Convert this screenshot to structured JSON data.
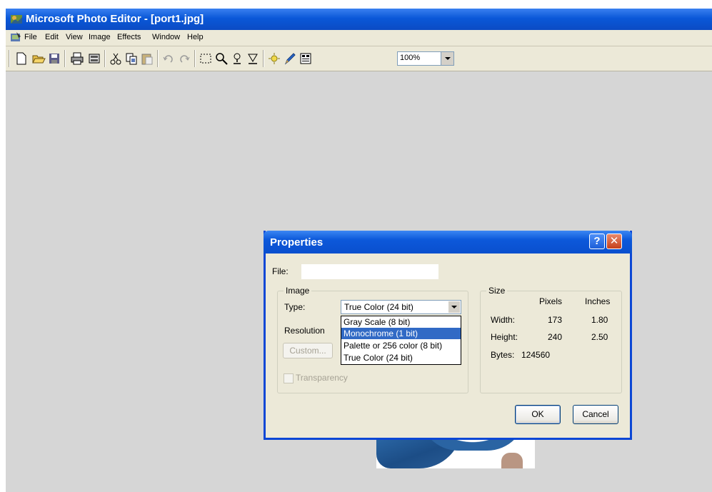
{
  "app": {
    "title": "Microsoft Photo Editor - [port1.jpg]",
    "colors": {
      "titlebar": "#0a58d8",
      "workspace": "#d6d6d6",
      "dialog_border": "#0c47d5",
      "selection": "#316ac5"
    }
  },
  "menu": {
    "items": [
      "File",
      "Edit",
      "View",
      "Image",
      "Effects",
      "Window",
      "Help"
    ]
  },
  "toolbar": {
    "icons": [
      "new-icon",
      "open-icon",
      "save-icon",
      "print-icon",
      "scan-icon",
      "cut-icon",
      "copy-icon",
      "paste-icon",
      "undo-icon",
      "redo-icon",
      "select-icon",
      "zoom-icon",
      "smudge-icon",
      "sharpen-icon",
      "transparent-icon",
      "pen-icon",
      "properties-icon"
    ],
    "zoom_value": "100%"
  },
  "dialog": {
    "title": "Properties",
    "help_glyph": "?",
    "close_glyph": "✕",
    "file_label": "File:",
    "file_value": "",
    "image_group": {
      "legend": "Image",
      "type_label": "Type:",
      "type_selected": "True Color (24 bit)",
      "type_options": [
        "Gray Scale (8 bit)",
        "Monochrome (1 bit)",
        "Palette or 256 color (8 bit)",
        "True Color (24 bit)"
      ],
      "highlighted_option": "Monochrome (1 bit)",
      "resolution_label": "Resolution",
      "custom_button": "Custom...",
      "transparency_label": "Transparency"
    },
    "size_group": {
      "legend": "Size",
      "col_pixels": "Pixels",
      "col_inches": "Inches",
      "width_label": "Width:",
      "width_pixels": "173",
      "width_inches": "1.80",
      "height_label": "Height:",
      "height_pixels": "240",
      "height_inches": "2.50",
      "bytes_label": "Bytes:",
      "bytes_value": "124560"
    },
    "ok_button": "OK",
    "cancel_button": "Cancel"
  }
}
